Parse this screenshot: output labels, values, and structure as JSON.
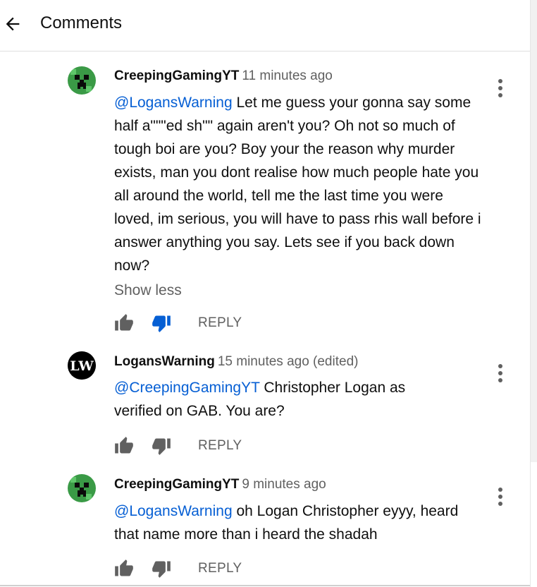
{
  "header": {
    "title": "Comments"
  },
  "comments": [
    {
      "author": "CreepingGamingYT",
      "time": "11 minutes ago",
      "mention": "@LogansWarning",
      "body": " Let me guess your gonna say some half a\"\"\"ed sh\"\" again aren't you? Oh not so much of tough boi are you? Boy your the reason why murder exists, man you dont realise how much people hate you all around the world, tell me the last time you were loved, im serious, you will have to pass rhis wall before i answer anything you say. Lets see if you back down now?",
      "show_less": "Show less",
      "reply": "REPLY",
      "disliked": true
    },
    {
      "author": "LogansWarning",
      "time": "15 minutes ago (edited)",
      "mention": "@CreepingGamingYT",
      "body": " Christopher Logan as verified on GAB. You are?",
      "reply": "REPLY",
      "avatar_text": "LW",
      "disliked": false
    },
    {
      "author": "CreepingGamingYT",
      "time": "9 minutes ago",
      "mention": "@LogansWarning",
      "body": " oh Logan Christopher eyyy, heard that name more than i heard the shadah",
      "reply": "REPLY",
      "disliked": false
    }
  ],
  "colors": {
    "link": "#065fd4",
    "secondary": "#606060",
    "disliked": "#065fd4",
    "creeper_bg": "#2e8b3a"
  }
}
